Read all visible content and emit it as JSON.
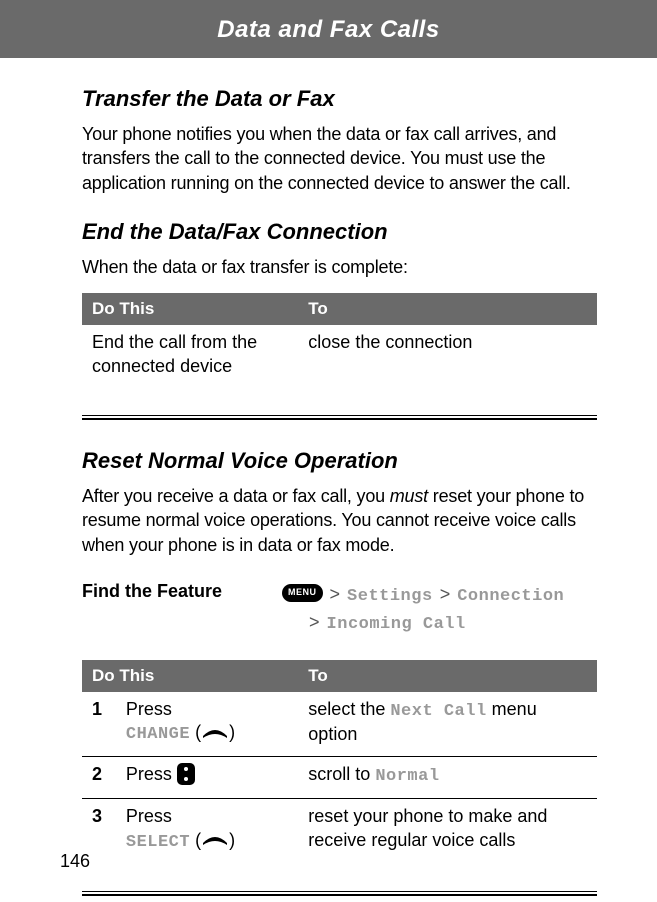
{
  "header": {
    "title": "Data and Fax Calls"
  },
  "page_number": "146",
  "section1": {
    "title": "Transfer the Data or Fax",
    "body": "Your phone notifies you when the data or fax call arrives, and transfers the call to the connected device. You must use the application running on the connected device to answer the call."
  },
  "section2": {
    "title": "End the Data/Fax Connection",
    "body": "When the data or fax transfer is complete:",
    "table": {
      "head_do": "Do This",
      "head_to": "To",
      "rows": [
        {
          "do": "End the call from the connected device",
          "to": "close the connection"
        }
      ]
    }
  },
  "section3": {
    "title": "Reset Normal Voice Operation",
    "body_pre": "After you receive a data or fax call, you ",
    "body_em": "must",
    "body_post": " reset your phone to resume normal voice operations. You cannot receive voice calls when your phone is in data or fax mode.",
    "find_label": "Find the Feature",
    "menu_key": "MENU",
    "path": {
      "p1": "Settings",
      "p2": "Connection",
      "p3": "Incoming Call"
    },
    "table": {
      "head_do": "Do This",
      "head_to": "To",
      "rows": [
        {
          "num": "1",
          "do_pre": "Press ",
          "do_key": "CHANGE",
          "to_pre": "select the ",
          "to_key": "Next Call",
          "to_post": " menu option"
        },
        {
          "num": "2",
          "do_pre": "Press ",
          "to_pre": "scroll to ",
          "to_key": "Normal"
        },
        {
          "num": "3",
          "do_pre": "Press ",
          "do_key": "SELECT",
          "to": "reset your phone to make and receive regular voice calls"
        }
      ]
    }
  }
}
